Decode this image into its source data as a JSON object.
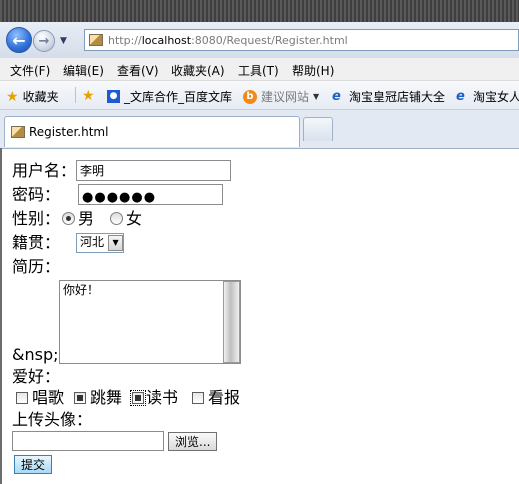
{
  "browser": {
    "address_url_prefix": "http://",
    "address_host": "localhost",
    "address_url_suffix": ":8080/Request/Register.html",
    "menu": [
      "文件(F)",
      "编辑(E)",
      "查看(V)",
      "收藏夹(A)",
      "工具(T)",
      "帮助(H)"
    ],
    "favorites_label": "收藏夹",
    "bookmarks": [
      "_文库合作_百度文库",
      "建议网站",
      "淘宝皇冠店铺大全",
      "淘宝女人"
    ],
    "tab_title": "Register.html"
  },
  "form": {
    "username_label": "用户名：",
    "username_value": "李明",
    "password_label": "密码：",
    "password_value": "●●●●●●",
    "gender_label": "性别：",
    "gender_options": [
      "男",
      "女"
    ],
    "gender_selected": "男",
    "hometown_label": "籍贯：",
    "hometown_value": "河北",
    "resume_label": "简历：",
    "resume_value": "你好！",
    "nbsp_text": "&nsp;",
    "hobby_label": "爱好：",
    "hobbies": [
      {
        "label": "唱歌",
        "checked": false
      },
      {
        "label": "跳舞",
        "checked": true
      },
      {
        "label": "读书",
        "checked": true
      },
      {
        "label": "看报",
        "checked": false
      }
    ],
    "avatar_label": "上传头像：",
    "browse_button": "浏览...",
    "submit_button": "提交"
  }
}
